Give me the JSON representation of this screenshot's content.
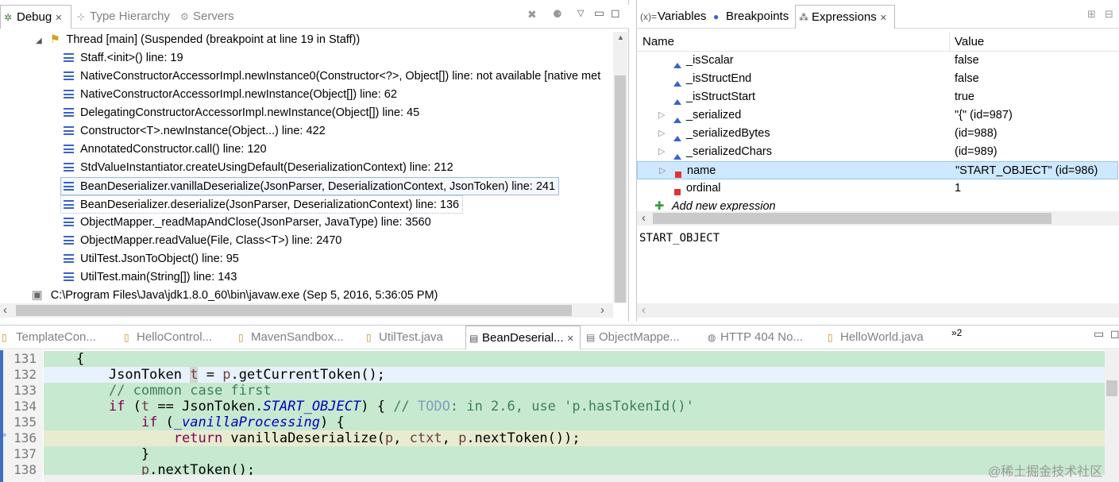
{
  "debug_view": {
    "tabs": [
      {
        "label": "Debug",
        "icon": "debug-icon"
      },
      {
        "label": "Type Hierarchy",
        "icon": "hierarchy-icon"
      },
      {
        "label": "Servers",
        "icon": "servers-icon"
      }
    ],
    "thread": "Thread [main] (Suspended (breakpoint at line 19 in Staff))",
    "frames": [
      "Staff.<init>() line: 19",
      "NativeConstructorAccessorImpl.newInstance0(Constructor<?>, Object[]) line: not available [native met",
      "NativeConstructorAccessorImpl.newInstance(Object[]) line: 62",
      "DelegatingConstructorAccessorImpl.newInstance(Object[]) line: 45",
      "Constructor<T>.newInstance(Object...) line: 422",
      "AnnotatedConstructor.call() line: 120",
      "StdValueInstantiator.createUsingDefault(DeserializationContext) line: 212",
      "BeanDeserializer.vanillaDeserialize(JsonParser, DeserializationContext, JsonToken) line: 241",
      "BeanDeserializer.deserialize(JsonParser, DeserializationContext) line: 136",
      "ObjectMapper._readMapAndClose(JsonParser, JavaType) line: 3560",
      "ObjectMapper.readValue(File, Class<T>) line: 2470",
      "UtilTest.JsonToObject() line: 95",
      "UtilTest.main(String[]) line: 143"
    ],
    "process": "C:\\Program Files\\Java\\jdk1.8.0_60\\bin\\javaw.exe (Sep 5, 2016, 5:36:05 PM)"
  },
  "expressions_view": {
    "tabs": [
      {
        "label": "Variables",
        "icon": "variables-icon"
      },
      {
        "label": "Breakpoints",
        "icon": "breakpoints-icon"
      },
      {
        "label": "Expressions",
        "icon": "expressions-icon"
      }
    ],
    "col_name": "Name",
    "col_value": "Value",
    "rows": [
      {
        "name": "_isScalar",
        "value": "false"
      },
      {
        "name": "_isStructEnd",
        "value": "false"
      },
      {
        "name": "_isStructStart",
        "value": "true"
      },
      {
        "name": "_serialized",
        "value": "\"{\" (id=987)"
      },
      {
        "name": "_serializedBytes",
        "value": "(id=988)"
      },
      {
        "name": "_serializedChars",
        "value": "(id=989)"
      },
      {
        "name": "name",
        "value": "\"START_OBJECT\" (id=986)"
      },
      {
        "name": "ordinal",
        "value": "1"
      }
    ],
    "add_expression": "Add new expression",
    "detail": "START_OBJECT"
  },
  "editor": {
    "tabs": [
      "TemplateCon...",
      "HelloControl...",
      "MavenSandbox...",
      "UtilTest.java",
      "BeanDeserial...",
      "ObjectMappe...",
      "HTTP 404 No...",
      "HelloWorld.java"
    ],
    "overflow": "»2",
    "line_numbers": [
      "131",
      "132",
      "133",
      "134",
      "135",
      "136",
      "137",
      "138"
    ]
  },
  "watermark": "@稀土掘金技术社区",
  "colors": {
    "highlight_green": "#c7e9cf",
    "selected_row": "#cde8ff",
    "keyword": "#7f0055",
    "comment": "#3f7f5f",
    "field": "#0000c0"
  }
}
